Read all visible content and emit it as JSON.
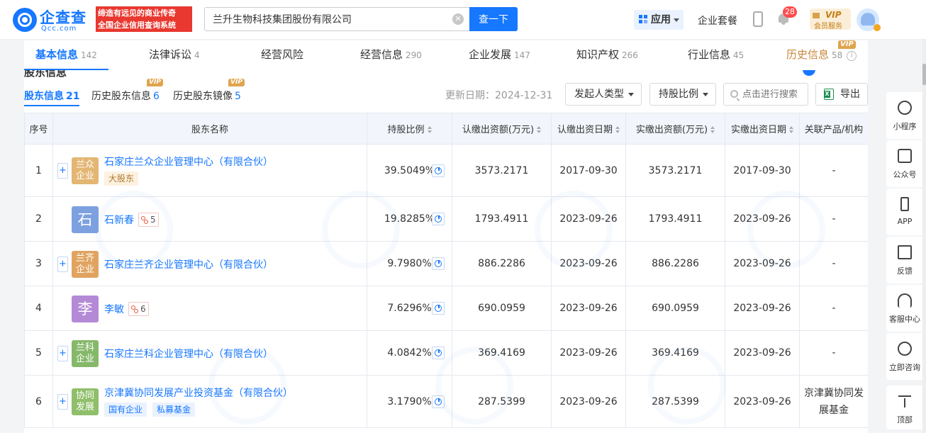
{
  "header": {
    "logo_cn": "企查查",
    "logo_en": "Qcc.com",
    "slogan_line1": "缔造有远见的商业传奇",
    "slogan_line2": "全国企业信用查询系统",
    "search_value": "兰升生物科技集团股份有限公司",
    "search_button": "查一下",
    "app_label": "应用",
    "package_label": "企业套餐",
    "notification_count": "28",
    "vip_word": "VIP",
    "vip_sub": "会员服务"
  },
  "tabs": [
    {
      "label": "基本信息",
      "count": "142"
    },
    {
      "label": "法律诉讼",
      "count": "4"
    },
    {
      "label": "经营风险",
      "count": ""
    },
    {
      "label": "经营信息",
      "count": "290"
    },
    {
      "label": "企业发展",
      "count": "147"
    },
    {
      "label": "知识产权",
      "count": "266"
    },
    {
      "label": "行业信息",
      "count": "45"
    },
    {
      "label": "历史信息",
      "count": "58"
    }
  ],
  "tab_vip_badge": "VIP",
  "section": {
    "peek_title": "股东信息",
    "subtabs": [
      {
        "label": "股东信息",
        "count": "21"
      },
      {
        "label": "历史股东信息",
        "count": "6"
      },
      {
        "label": "历史股东镜像",
        "count": "5"
      }
    ],
    "subtab_vip": "VIP",
    "update_date": "更新日期：2024-12-31",
    "filter_sponsor": "发起人类型",
    "filter_ratio": "持股比例",
    "filter_search_placeholder": "点击进行搜索",
    "export_label": "导出"
  },
  "table": {
    "headers": [
      "序号",
      "股东名称",
      "持股比例",
      "认缴出资额(万元)",
      "认缴出资日期",
      "实缴出资额(万元)",
      "实缴出资日期",
      "关联产品/机构"
    ],
    "rows": [
      {
        "no": "1",
        "logo_text": "兰众企业",
        "logo_color": "#e3b673",
        "kind": "ent",
        "name": "石家庄兰众企业管理中心（有限合伙）",
        "tags": [
          "大股东"
        ],
        "tag_style": "gold",
        "rel": "",
        "ratio": "39.5049%",
        "sub_amount": "3573.2171",
        "sub_date": "2017-09-30",
        "paid_amount": "3573.2171",
        "paid_date": "2017-09-30",
        "related": "-"
      },
      {
        "no": "2",
        "logo_text": "石",
        "logo_color": "#7da1e0",
        "kind": "person",
        "name": "石新春",
        "tags": [],
        "tag_style": "",
        "rel": "5",
        "ratio": "19.8285%",
        "sub_amount": "1793.4911",
        "sub_date": "2023-09-26",
        "paid_amount": "1793.4911",
        "paid_date": "2023-09-26",
        "related": "-"
      },
      {
        "no": "3",
        "logo_text": "兰齐企业",
        "logo_color": "#e0a460",
        "kind": "ent",
        "name": "石家庄兰齐企业管理中心（有限合伙）",
        "tags": [],
        "tag_style": "",
        "rel": "",
        "ratio": "9.7980%",
        "sub_amount": "886.2286",
        "sub_date": "2023-09-26",
        "paid_amount": "886.2286",
        "paid_date": "2023-09-26",
        "related": "-"
      },
      {
        "no": "4",
        "logo_text": "李",
        "logo_color": "#b48ad6",
        "kind": "person",
        "name": "李敏",
        "tags": [],
        "tag_style": "",
        "rel": "6",
        "ratio": "7.6296%",
        "sub_amount": "690.0959",
        "sub_date": "2023-09-26",
        "paid_amount": "690.0959",
        "paid_date": "2023-09-26",
        "related": "-"
      },
      {
        "no": "5",
        "logo_text": "兰科企业",
        "logo_color": "#86b86a",
        "kind": "ent",
        "name": "石家庄兰科企业管理中心（有限合伙）",
        "tags": [],
        "tag_style": "",
        "rel": "",
        "ratio": "4.0842%",
        "sub_amount": "369.4169",
        "sub_date": "2023-09-26",
        "paid_amount": "369.4169",
        "paid_date": "2023-09-26",
        "related": "-"
      },
      {
        "no": "6",
        "logo_text": "协同发展",
        "logo_color": "#8fbf6a",
        "kind": "ent",
        "name": "京津冀协同发展产业投资基金（有限合伙）",
        "tags": [
          "国有企业",
          "私募基金"
        ],
        "tag_style": "blue",
        "rel": "",
        "ratio": "3.1790%",
        "sub_amount": "287.5399",
        "sub_date": "2023-09-26",
        "paid_amount": "287.5399",
        "paid_date": "2023-09-26",
        "related": "京津冀协同发展基金"
      }
    ]
  },
  "sidebar": [
    {
      "label": "小程序",
      "icon": "mini-program-icon"
    },
    {
      "label": "公众号",
      "icon": "official-account-icon"
    },
    {
      "label": "APP",
      "icon": "mobile-app-icon"
    },
    {
      "label": "反馈",
      "icon": "feedback-icon"
    },
    {
      "label": "客服中心",
      "icon": "headset-icon"
    },
    {
      "label": "立即咨询",
      "icon": "chat-icon"
    },
    {
      "label": "顶部",
      "icon": "back-to-top-icon"
    }
  ],
  "colors": {
    "accent": "#1677ff",
    "slogan_bg": "#e8382f",
    "history_tab": "#c9873a"
  }
}
